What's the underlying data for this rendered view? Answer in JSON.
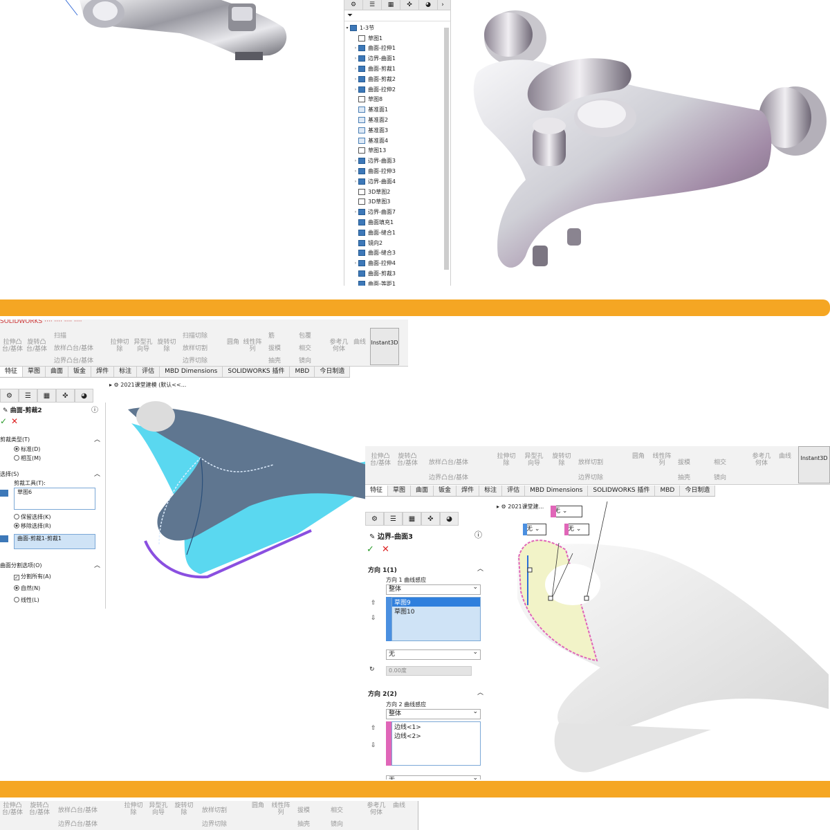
{
  "tree": {
    "tab_icons": [
      "feature-tab-icon",
      "property-tab-icon",
      "config-tab-icon",
      "origin-tab-icon",
      "display-tab-icon"
    ],
    "root": "1-3节",
    "items": [
      {
        "label": "草图1",
        "type": "sketch",
        "exp": ""
      },
      {
        "label": "曲面-拉伸1",
        "type": "feature",
        "exp": "›"
      },
      {
        "label": "边界-曲面1",
        "type": "feature",
        "exp": "›"
      },
      {
        "label": "曲面-剪裁1",
        "type": "feature",
        "exp": "›"
      },
      {
        "label": "曲面-剪裁2",
        "type": "feature",
        "exp": "›"
      },
      {
        "label": "曲面-拉伸2",
        "type": "feature",
        "exp": "›"
      },
      {
        "label": "草图8",
        "type": "sketch",
        "exp": ""
      },
      {
        "label": "基准面1",
        "type": "plane",
        "exp": ""
      },
      {
        "label": "基准面2",
        "type": "plane",
        "exp": ""
      },
      {
        "label": "基准面3",
        "type": "plane",
        "exp": ""
      },
      {
        "label": "基准面4",
        "type": "plane",
        "exp": ""
      },
      {
        "label": "草图13",
        "type": "sketch",
        "exp": ""
      },
      {
        "label": "边界-曲面3",
        "type": "feature",
        "exp": "›"
      },
      {
        "label": "曲面-拉伸3",
        "type": "feature",
        "exp": "›"
      },
      {
        "label": "边界-曲面4",
        "type": "feature",
        "exp": "›"
      },
      {
        "label": "3D草图2",
        "type": "sketch",
        "exp": ""
      },
      {
        "label": "3D草图3",
        "type": "sketch",
        "exp": ""
      },
      {
        "label": "边界-曲面7",
        "type": "feature",
        "exp": "›"
      },
      {
        "label": "曲面填充1",
        "type": "feature",
        "exp": ""
      },
      {
        "label": "曲面-缝合1",
        "type": "feature",
        "exp": ""
      },
      {
        "label": "镜向2",
        "type": "feature",
        "exp": ""
      },
      {
        "label": "曲面-缝合3",
        "type": "feature",
        "exp": ""
      },
      {
        "label": "曲面-拉伸4",
        "type": "feature",
        "exp": "›"
      },
      {
        "label": "曲面-剪裁3",
        "type": "feature",
        "exp": ""
      },
      {
        "label": "曲面-等距1",
        "type": "feature",
        "exp": ""
      }
    ]
  },
  "ribbon": {
    "extrude_boss": "拉伸凸台/基体",
    "revolve_boss": "旋转凸台/基体",
    "sweep": "扫描",
    "loft_boss": "放样凸台/基体",
    "boundary_boss": "边界凸台/基体",
    "extrude_cut": "拉伸切除",
    "hole_wizard": "异型孔向导",
    "revolve_cut": "旋转切除",
    "sweep_cut": "扫描切除",
    "loft_cut": "放样切割",
    "boundary_cut": "边界切除",
    "fillet": "圆角",
    "linear_pattern": "线性阵列",
    "rib": "筋",
    "draft": "拔模",
    "shell": "抽壳",
    "wrap": "包覆",
    "intersect": "相交",
    "mirror": "镜向",
    "ref_geometry": "参考几何体",
    "curves": "曲线",
    "instant3d": "Instant3D"
  },
  "tabs": [
    "特征",
    "草图",
    "曲面",
    "钣金",
    "焊件",
    "标注",
    "评估",
    "MBD Dimensions",
    "SOLIDWORKS 插件",
    "MBD",
    "今日制造"
  ],
  "trim": {
    "breadcrumb": "2021课堂建模 (默认<<...",
    "title": "曲面-剪裁2",
    "type_section": "剪裁类型(T)",
    "opt_standard": "标准(D)",
    "opt_mutual": "相互(M)",
    "select_section": "选择(S)",
    "trim_tool": "剪裁工具(T):",
    "trim_tool_value": "草图6",
    "opt_keep": "保留选择(K)",
    "opt_remove": "移除选择(R)",
    "selected_face": "曲面-剪裁1-剪裁1",
    "split_section": "曲面分割选项(O)",
    "split_all": "分割所有(A)",
    "natural": "自然(N)",
    "linear": "线性(L)"
  },
  "boundary": {
    "breadcrumb": "2021课堂建...",
    "title": "边界-曲面3",
    "dir1": "方向 1(1)",
    "dir1_influence": "方向 1 曲线感应",
    "whole": "整体",
    "dir1_items": [
      "草图9",
      "草图10"
    ],
    "none": "无",
    "angle": "0.00度",
    "dir2": "方向 2(2)",
    "dir2_influence": "方向 2 曲线感应",
    "dir2_items": [
      "边线<1>",
      "边线<2>"
    ],
    "tag_none": "无"
  },
  "colors": {
    "accent_bar": "#f5a623",
    "selection": "#cfe3f6",
    "surface_blue": "#5ad8f0",
    "surface_gray": "#5f7690",
    "pink": "#e066b8"
  }
}
